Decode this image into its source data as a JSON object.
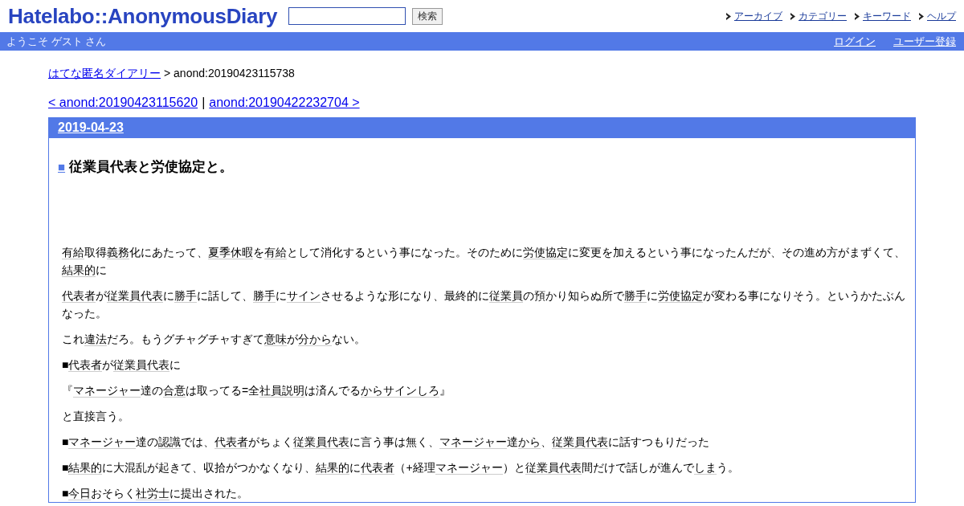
{
  "header": {
    "logo": "Hatelabo::AnonymousDiary",
    "search_button": "検索",
    "nav": [
      "アーカイブ",
      "カテゴリー",
      "キーワード",
      "ヘルプ"
    ]
  },
  "userbar": {
    "welcome": "ようこそ ゲスト さん",
    "links": [
      "ログイン",
      "ユーザー登録"
    ]
  },
  "breadcrumb": {
    "link": "はてな匿名ダイアリー",
    "current": "> anond:20190423115738"
  },
  "pager": {
    "prev": "< anond:20190423115620",
    "separator": "|",
    "next": "anond:20190422232704 >"
  },
  "day": {
    "date": "2019-04-23",
    "title_mark": "■",
    "title": "従業員代表と労使協定と。",
    "paragraphs": [
      [
        {
          "text": "有給",
          "keyword": true
        },
        {
          "text": "取得",
          "keyword": false
        },
        {
          "text": "義務",
          "keyword": true
        },
        {
          "text": "化にあたって、",
          "keyword": false
        },
        {
          "text": "夏季休暇",
          "keyword": true
        },
        {
          "text": "を",
          "keyword": false
        },
        {
          "text": "有給",
          "keyword": true
        },
        {
          "text": "として消化するという事になった。そのために",
          "keyword": false
        },
        {
          "text": "労使協定",
          "keyword": true
        },
        {
          "text": "に変更を加えるという事になったんだが、その進め方がまずくて、",
          "keyword": false
        },
        {
          "text": "結果的",
          "keyword": true
        },
        {
          "text": "に",
          "keyword": false
        }
      ],
      [
        {
          "text": "代表者",
          "keyword": true
        },
        {
          "text": "が",
          "keyword": false
        },
        {
          "text": "従業員代表",
          "keyword": true
        },
        {
          "text": "に",
          "keyword": false
        },
        {
          "text": "勝手",
          "keyword": true
        },
        {
          "text": "に話して、",
          "keyword": false
        },
        {
          "text": "勝手",
          "keyword": true
        },
        {
          "text": "に",
          "keyword": false
        },
        {
          "text": "サイン",
          "keyword": true
        },
        {
          "text": "させるような形になり、最終的に",
          "keyword": false
        },
        {
          "text": "従業員",
          "keyword": true
        },
        {
          "text": "の預かり知らぬ所で",
          "keyword": false
        },
        {
          "text": "勝手",
          "keyword": true
        },
        {
          "text": "に",
          "keyword": false
        },
        {
          "text": "労使協定",
          "keyword": true
        },
        {
          "text": "が変わる事になりそう。というかたぶんなった。",
          "keyword": false
        }
      ],
      [
        {
          "text": "これ",
          "keyword": false
        },
        {
          "text": "違法",
          "keyword": true
        },
        {
          "text": "だろ。もうグチャグチャすぎて",
          "keyword": false
        },
        {
          "text": "意味",
          "keyword": true
        },
        {
          "text": "が",
          "keyword": false
        },
        {
          "text": "分から",
          "keyword": true
        },
        {
          "text": "ない。",
          "keyword": false
        }
      ],
      [
        {
          "text": "■",
          "keyword": false
        },
        {
          "text": "代表者",
          "keyword": true
        },
        {
          "text": "が",
          "keyword": false
        },
        {
          "text": "従業員代表",
          "keyword": true
        },
        {
          "text": "に",
          "keyword": false
        }
      ],
      [
        {
          "text": "『",
          "keyword": false
        },
        {
          "text": "マネージャー",
          "keyword": true
        },
        {
          "text": "達の",
          "keyword": false
        },
        {
          "text": "合意",
          "keyword": true
        },
        {
          "text": "は取ってる=全",
          "keyword": false
        },
        {
          "text": "社員",
          "keyword": true
        },
        {
          "text": "説明",
          "keyword": true
        },
        {
          "text": "は済んでる",
          "keyword": false
        },
        {
          "text": "からサインしろ",
          "keyword": true
        },
        {
          "text": "』",
          "keyword": false
        }
      ],
      [
        {
          "text": "と直接言う。",
          "keyword": false
        }
      ],
      [
        {
          "text": "■",
          "keyword": false
        },
        {
          "text": "マネージャー",
          "keyword": true
        },
        {
          "text": "達の",
          "keyword": false
        },
        {
          "text": "認識",
          "keyword": true
        },
        {
          "text": "では、",
          "keyword": false
        },
        {
          "text": "代表者",
          "keyword": true
        },
        {
          "text": "がちょく",
          "keyword": false
        },
        {
          "text": "従業員代表",
          "keyword": true
        },
        {
          "text": "に言う事は無く、",
          "keyword": false
        },
        {
          "text": "マネージャー",
          "keyword": true
        },
        {
          "text": "達",
          "keyword": false
        },
        {
          "text": "から",
          "keyword": true
        },
        {
          "text": "、",
          "keyword": false
        },
        {
          "text": "従業員代表",
          "keyword": true
        },
        {
          "text": "に話すつもりだった",
          "keyword": false
        }
      ],
      [
        {
          "text": "■",
          "keyword": false
        },
        {
          "text": "結果的",
          "keyword": true
        },
        {
          "text": "に大混乱が起きて、収拾がつかなくなり、",
          "keyword": false
        },
        {
          "text": "結果的",
          "keyword": true
        },
        {
          "text": "に",
          "keyword": false
        },
        {
          "text": "代表者",
          "keyword": true
        },
        {
          "text": "（+経理",
          "keyword": false
        },
        {
          "text": "マネージャー",
          "keyword": true
        },
        {
          "text": "）と",
          "keyword": false
        },
        {
          "text": "従業員代表",
          "keyword": true
        },
        {
          "text": "間だけで話しが進んで",
          "keyword": false
        },
        {
          "text": "しま",
          "keyword": true
        },
        {
          "text": "う。",
          "keyword": false
        }
      ],
      [
        {
          "text": "■",
          "keyword": false
        },
        {
          "text": "今日",
          "keyword": true
        },
        {
          "text": "おそらく",
          "keyword": false
        },
        {
          "text": "社労士",
          "keyword": true
        },
        {
          "text": "に提出された。",
          "keyword": false
        }
      ]
    ]
  }
}
